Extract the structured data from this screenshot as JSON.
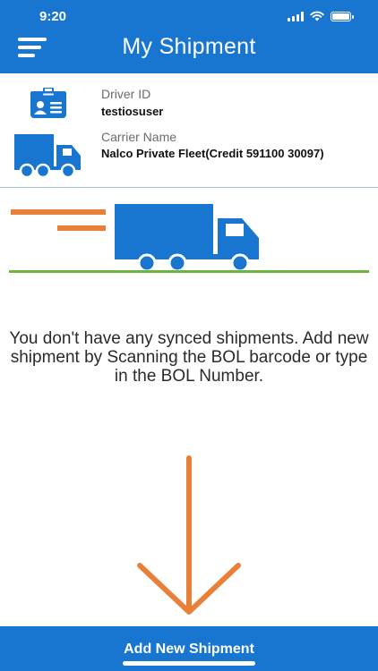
{
  "status_bar": {
    "time": "9:20",
    "icons": [
      "signal-icon",
      "wifi-icon",
      "battery-icon"
    ]
  },
  "header": {
    "title": "My Shipment",
    "menu_icon": "menu-icon",
    "color": "#1876d0"
  },
  "driver": {
    "label": "Driver ID",
    "value": "testiosuser",
    "icon": "id-card-icon"
  },
  "carrier": {
    "label": "Carrier Name",
    "value": "Nalco Private Fleet(Credit 591100 30097)",
    "icon": "truck-icon"
  },
  "empty_state": {
    "illustration": "moving-truck-illustration",
    "message": "You don't have any synced shipments. Add new shipment by Scanning the BOL barcode or type in the BOL Number.",
    "arrow_icon": "arrow-down-icon",
    "arrow_color": "#e8803a"
  },
  "footer": {
    "button_label": "Add New Shipment"
  },
  "colors": {
    "primary": "#1876d0",
    "accent": "#e8803a",
    "ground": "#6cb33f"
  }
}
